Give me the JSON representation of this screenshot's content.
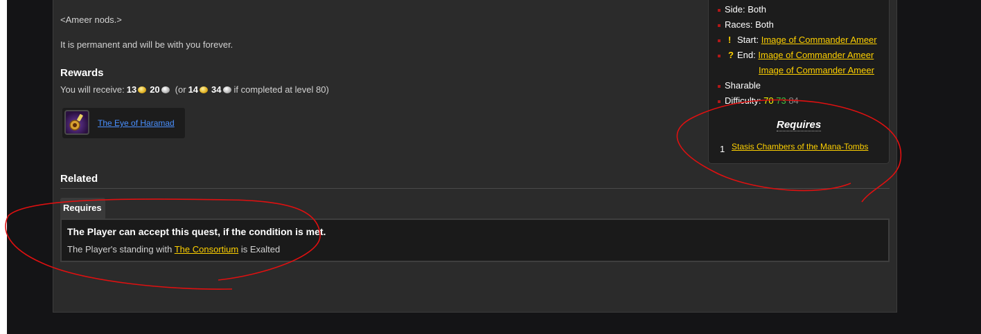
{
  "quest_text": {
    "nod_line": "<Ameer nods.>",
    "permanent_line": "It is permanent and will be with you forever."
  },
  "rewards": {
    "heading": "Rewards",
    "receive_prefix": "You will receive:",
    "gold": "13",
    "silver": "20",
    "alt_prefix": "(or",
    "alt_gold": "14",
    "alt_silver": "34",
    "alt_suffix": "if completed at level 80)",
    "item_name": "The Eye of Haramad",
    "item_icon": "eye-of-haramad-icon"
  },
  "related": {
    "heading": "Related",
    "tab_label": "Requires",
    "condition_title": "The Player can accept this quest, if the condition is met.",
    "condition_prefix": "The Player's standing with",
    "condition_faction": "The Consortium",
    "condition_suffix": "is Exalted"
  },
  "infobox": {
    "side": "Side: Both",
    "races": "Races: Both",
    "start_label": "Start:",
    "start_npc": "Image of Commander Ameer",
    "end_label": "End:",
    "end_npc_1": "Image of Commander Ameer",
    "end_npc_2": "Image of Commander Ameer",
    "sharable": "Sharable",
    "difficulty_label": "Difficulty:",
    "difficulty_values": [
      "70",
      "73",
      "84"
    ],
    "requires_title": "Requires",
    "requires_index": "1",
    "requires_link": "Stasis Chambers of the Mana-Tombs"
  },
  "colors": {
    "link_yellow": "#ffd100",
    "link_blue": "#4a90ff",
    "annotation_red": "#e01010"
  }
}
